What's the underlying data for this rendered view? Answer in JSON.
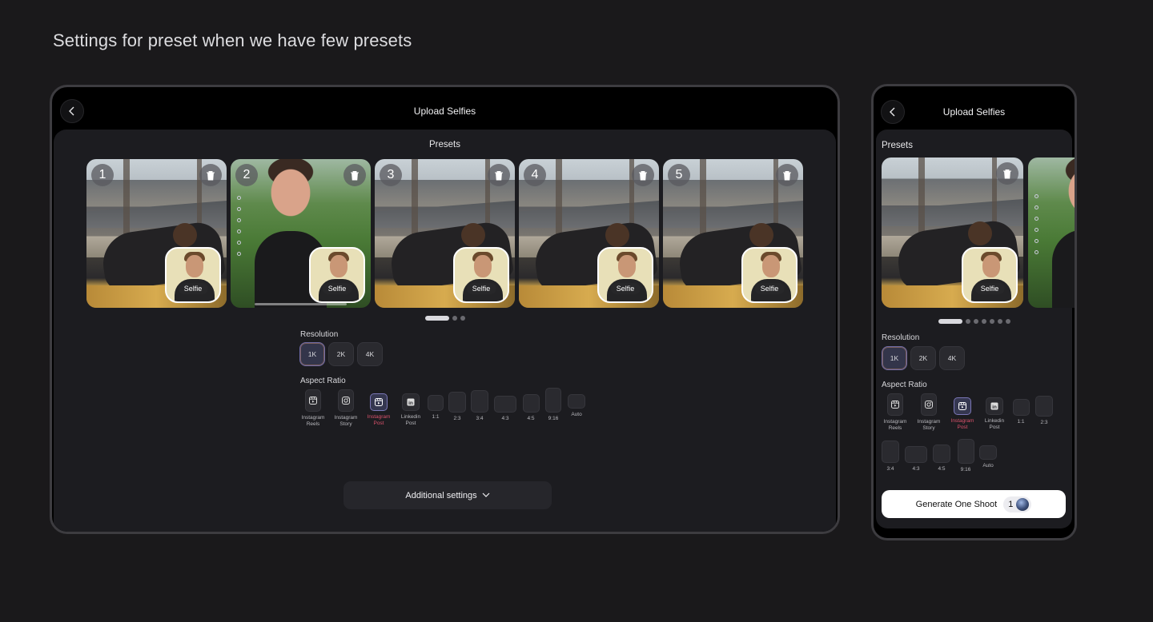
{
  "page_title": "Settings for preset when we have few presets",
  "screen_title": "Upload Selfies",
  "presets_label": "Presets",
  "presets": [
    {
      "number": "1",
      "selfie_label": "Selfie"
    },
    {
      "number": "2",
      "selfie_label": "Selfie"
    },
    {
      "number": "3",
      "selfie_label": "Selfie"
    },
    {
      "number": "4",
      "selfie_label": "Selfie"
    },
    {
      "number": "5",
      "selfie_label": "Selfie"
    }
  ],
  "resolution": {
    "label": "Resolution",
    "options": [
      "1K",
      "2K",
      "4K"
    ],
    "selected": "1K"
  },
  "aspect_ratio": {
    "label": "Aspect Ratio",
    "options": [
      {
        "line1": "Instagram",
        "line2": "Reels"
      },
      {
        "line1": "Instagram",
        "line2": "Story"
      },
      {
        "line1": "Instagram",
        "line2": "Post"
      },
      {
        "line1": "Linkedin",
        "line2": "Post"
      },
      {
        "line1": "1:1"
      },
      {
        "line1": "2:3"
      },
      {
        "line1": "3:4"
      },
      {
        "line1": "4:3"
      },
      {
        "line1": "4:5"
      },
      {
        "line1": "9:16"
      },
      {
        "line1": "Auto"
      }
    ],
    "selected": "Instagram Post"
  },
  "additional_settings_label": "Additional settings",
  "generate": {
    "label": "Generate One Shoot",
    "count": "1"
  },
  "pagination": {
    "tablet_pages": 3,
    "phone_pages": 7,
    "active": 0
  }
}
